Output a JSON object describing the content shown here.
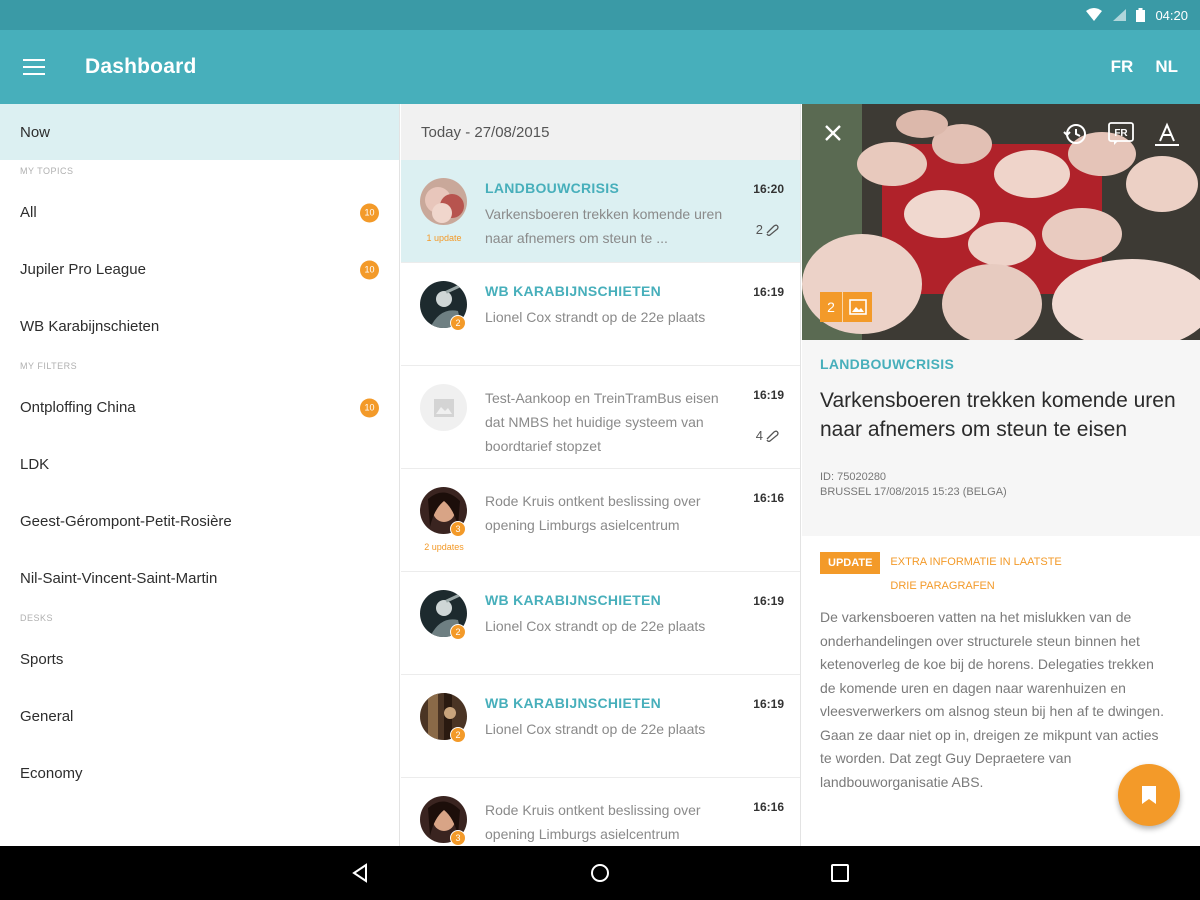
{
  "status": {
    "time": "04:20"
  },
  "appbar": {
    "title": "Dashboard",
    "langs": [
      "FR",
      "NL"
    ]
  },
  "sidebar": {
    "now": "Now",
    "topics_head": "MY TOPICS",
    "topics": [
      {
        "label": "All",
        "badge": "10"
      },
      {
        "label": "Jupiler Pro League",
        "badge": "10"
      },
      {
        "label": "WB Karabijnschieten",
        "badge": ""
      }
    ],
    "filters_head": "MY FILTERS",
    "filters": [
      {
        "label": "Ontploffing China",
        "badge": "10"
      },
      {
        "label": "LDK",
        "badge": ""
      },
      {
        "label": "Geest-Gérompont-Petit-Rosière",
        "badge": ""
      },
      {
        "label": "Nil-Saint-Vincent-Saint-Martin",
        "badge": ""
      }
    ],
    "desks_head": "DESKS",
    "desks": [
      {
        "label": "Sports"
      },
      {
        "label": "General"
      },
      {
        "label": "Economy"
      }
    ]
  },
  "feed": {
    "date": "Today - 27/08/2015",
    "items": [
      {
        "topic": "LANDBOUWCRISIS",
        "text": "Varkensboeren trekken komende uren naar afnemers om steun te ...",
        "time": "16:20",
        "attach": "2",
        "badge": "",
        "note": "1 update"
      },
      {
        "topic": "WB KARABIJNSCHIETEN",
        "text": "Lionel Cox strandt op de 22e plaats",
        "time": "16:19",
        "attach": "",
        "badge": "2",
        "note": ""
      },
      {
        "topic": "",
        "text": "Test-Aankoop en TreinTramBus eisen dat NMBS het huidige systeem van boordtarief stopzet",
        "time": "16:19",
        "attach": "4",
        "badge": "",
        "note": ""
      },
      {
        "topic": "",
        "text": "Rode Kruis ontkent beslissing over opening Limburgs asielcentrum",
        "time": "16:16",
        "attach": "",
        "badge": "3",
        "note": "2 updates"
      },
      {
        "topic": "WB KARABIJNSCHIETEN",
        "text": "Lionel Cox strandt op de 22e plaats",
        "time": "16:19",
        "attach": "",
        "badge": "2",
        "note": ""
      },
      {
        "topic": "WB KARABIJNSCHIETEN",
        "text": "Lionel Cox strandt op de 22e plaats",
        "time": "16:19",
        "attach": "",
        "badge": "2",
        "note": ""
      },
      {
        "topic": "",
        "text": "Rode Kruis ontkent beslissing over opening Limburgs asielcentrum",
        "time": "16:16",
        "attach": "",
        "badge": "3",
        "note": ""
      }
    ]
  },
  "detail": {
    "image_count": "2",
    "lang_tool": "FR",
    "topic": "LANDBOUWCRISIS",
    "title": "Varkensboeren trekken komende uren naar afnemers om steun te eisen",
    "id_line": "ID: 75020280",
    "dateline": "BRUSSEL 17/08/2015 15:23 (BELGA)",
    "update_tag": "UPDATE",
    "update_info": "EXTRA INFORMATIE IN LAATSTE DRIE PARAGRAFEN",
    "body": "De varkensboeren vatten na het mislukken van de onderhandelingen over structurele steun binnen het ketenoverleg de koe bij de horens. Delegaties trekken de komende uren en dagen naar warenhuizen en vleesverwerkers om alsnog steun bij hen af te dwingen. Gaan ze daar niet op in, dreigen ze mikpunt van acties te worden. Dat zegt Guy Depraetere van landbouworganisatie ABS."
  },
  "colors": {
    "teal": "#47afbb",
    "orange": "#f39a29",
    "selected_bg": "#dcf0f2"
  }
}
